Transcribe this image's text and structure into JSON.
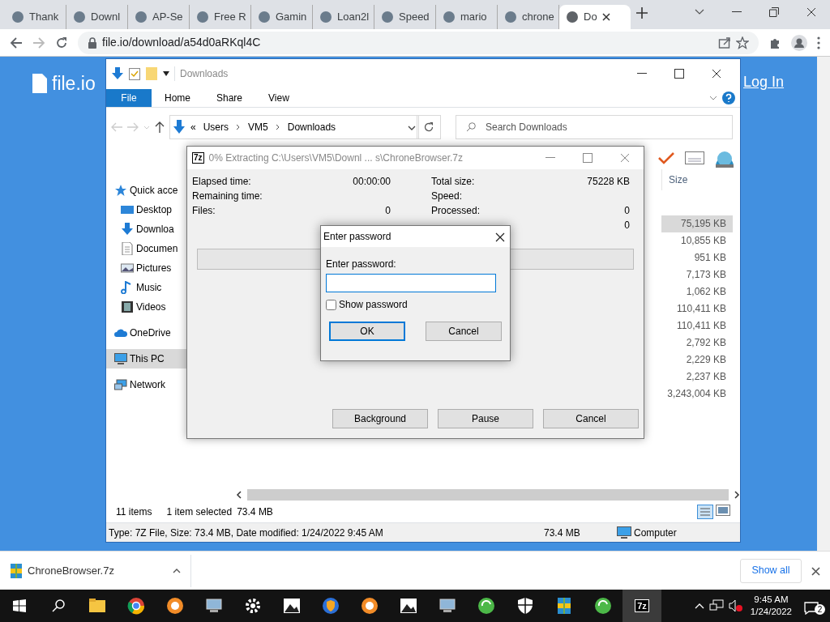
{
  "browser": {
    "tabs": [
      {
        "title": "Thank",
        "selected": false
      },
      {
        "title": "Downl",
        "selected": false
      },
      {
        "title": "AP-Se",
        "selected": false
      },
      {
        "title": "Free R",
        "selected": false
      },
      {
        "title": "Gamin",
        "selected": false
      },
      {
        "title": "Loan2l",
        "selected": false
      },
      {
        "title": "Speed",
        "selected": false
      },
      {
        "title": "mario",
        "selected": false
      },
      {
        "title": "chrone",
        "selected": false
      },
      {
        "title": "Do",
        "selected": true
      }
    ],
    "url": "file.io/download/a54d0aRKql4C"
  },
  "page": {
    "logo": "file.io",
    "login": "Log In"
  },
  "explorer": {
    "title": "Downloads",
    "ribbon_tabs": [
      {
        "label": "File",
        "selected": true
      },
      {
        "label": "Home",
        "selected": false
      },
      {
        "label": "Share",
        "selected": false
      },
      {
        "label": "View",
        "selected": false
      }
    ],
    "breadcrumb_overflow": "«",
    "breadcrumb": [
      "Users",
      "VM5",
      "Downloads"
    ],
    "search_placeholder": "Search Downloads",
    "nav": [
      {
        "label": "Quick acce",
        "kind": "star",
        "selected": false,
        "children": [
          {
            "label": "Desktop",
            "kind": "desktop",
            "selected": false
          },
          {
            "label": "Downloa",
            "kind": "download",
            "selected": false
          },
          {
            "label": "Documen",
            "kind": "document",
            "selected": false
          },
          {
            "label": "Pictures",
            "kind": "pictures",
            "selected": false
          },
          {
            "label": "Music",
            "kind": "music",
            "selected": false
          },
          {
            "label": "Videos",
            "kind": "videos",
            "selected": false
          }
        ]
      },
      {
        "label": "OneDrive",
        "kind": "cloud",
        "selected": false
      },
      {
        "label": "This PC",
        "kind": "pc",
        "selected": true
      },
      {
        "label": "Network",
        "kind": "network",
        "selected": false
      }
    ],
    "size_header": "Size",
    "sizes": [
      {
        "value": "75,195 KB",
        "selected": true
      },
      {
        "value": "10,855 KB",
        "selected": false
      },
      {
        "value": "951 KB",
        "selected": false
      },
      {
        "value": "7,173 KB",
        "selected": false
      },
      {
        "value": "1,062 KB",
        "selected": false
      },
      {
        "value": "110,411 KB",
        "selected": false
      },
      {
        "value": "110,411 KB",
        "selected": false
      },
      {
        "value": "2,792 KB",
        "selected": false
      },
      {
        "value": "2,229 KB",
        "selected": false
      },
      {
        "value": "2,237 KB",
        "selected": false
      },
      {
        "value": "3,243,004 KB",
        "selected": false
      }
    ],
    "item_count": "11 items",
    "selection_info": "1 item selected",
    "selection_size": "73.4 MB",
    "details": "Type: 7Z File, Size: 73.4 MB, Date modified: 1/24/2022 9:45 AM",
    "details_size": "73.4 MB",
    "details_location": "Computer"
  },
  "extract": {
    "icon_label": "7z",
    "title": "0% Extracting C:\\Users\\VM5\\Downl ... s\\ChroneBrowser.7z",
    "stats_left": [
      {
        "label": "Elapsed time:",
        "value": "00:00:00"
      },
      {
        "label": "Remaining time:"
      },
      {
        "label": "Files:",
        "value": "0"
      }
    ],
    "stats_right": [
      {
        "label": "Total size:",
        "value": "75228 KB"
      },
      {
        "label": "Speed:"
      },
      {
        "label": "Processed:",
        "value": "0"
      },
      {
        "value": "0"
      }
    ],
    "progress": {
      "level": 0
    },
    "buttons": [
      "Background",
      "Pause",
      "Cancel"
    ]
  },
  "password": {
    "title": "Enter password",
    "label": "Enter password:",
    "focused": true,
    "show_password": {
      "label": "Show password",
      "checked": false
    },
    "buttons": [
      {
        "label": "OK",
        "default": true
      },
      {
        "label": "Cancel",
        "default": false
      }
    ]
  },
  "downloads": {
    "file": "ChroneBrowser.7z",
    "show_all": "Show all"
  },
  "taskbar": {
    "apps": [
      {
        "kind": "folder",
        "selected": false
      },
      {
        "kind": "browser",
        "selected": false
      },
      {
        "kind": "app",
        "selected": false
      },
      {
        "kind": "computer",
        "selected": false
      },
      {
        "kind": "settings",
        "selected": false
      },
      {
        "kind": "photos",
        "selected": false
      },
      {
        "kind": "shield-browser",
        "selected": false
      },
      {
        "kind": "app",
        "selected": false
      },
      {
        "kind": "photos",
        "selected": false
      },
      {
        "kind": "computer",
        "selected": false
      },
      {
        "kind": "refresh",
        "selected": false
      },
      {
        "kind": "security",
        "selected": false
      },
      {
        "kind": "archive",
        "selected": false
      },
      {
        "kind": "refresh",
        "selected": false
      },
      {
        "kind": "sevenzip",
        "label": "7z",
        "selected": true
      }
    ],
    "time": "9:45 AM",
    "date": "1/24/2022",
    "notifications": "2"
  }
}
